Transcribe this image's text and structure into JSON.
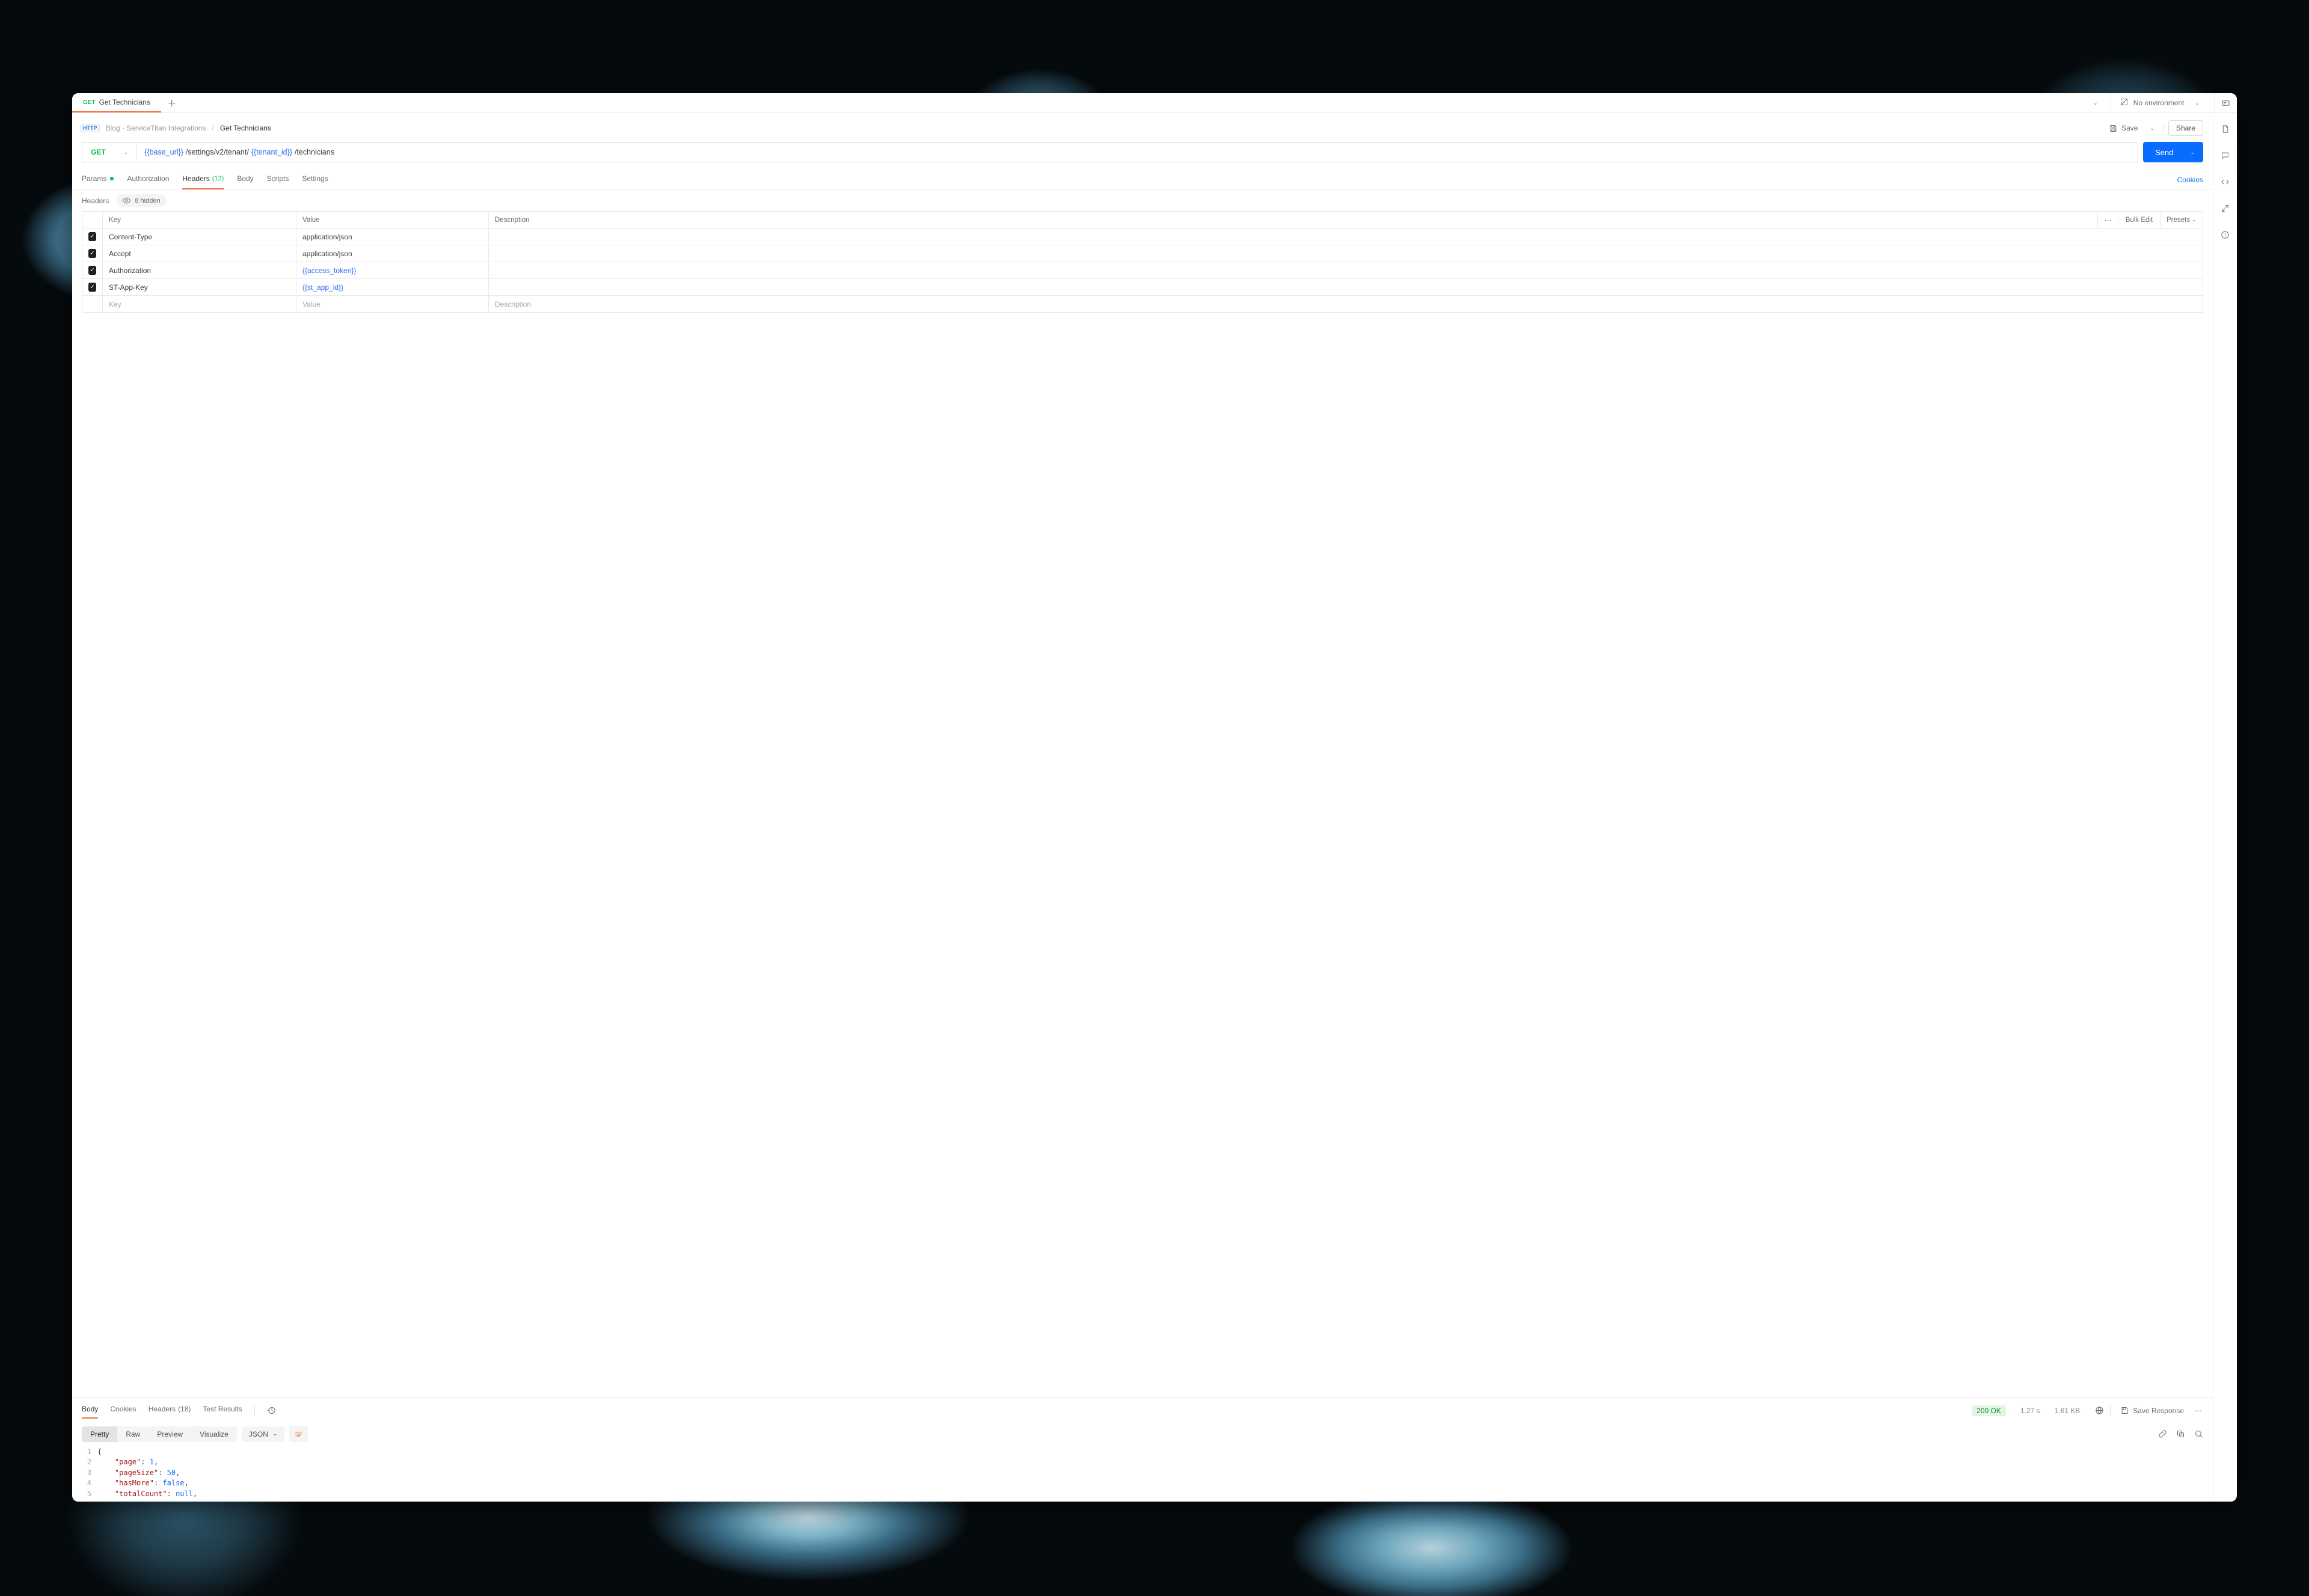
{
  "tabs": {
    "items": [
      {
        "method": "GET",
        "label": "Get Technicians",
        "active": true
      }
    ]
  },
  "environment": {
    "label": "No environment"
  },
  "breadcrumb": {
    "collection": "Blog - ServiceTitan Integrations",
    "request": "Get Technicians"
  },
  "actions": {
    "save": "Save",
    "share": "Share"
  },
  "urlbar": {
    "method": "GET",
    "parts": {
      "var1": "{{base_url}}",
      "seg1": " /settings/v2/tenant/ ",
      "var2": "{{tenant_id}}",
      "seg2": " /technicians"
    },
    "send": "Send"
  },
  "reqTabs": {
    "params": "Params",
    "authorization": "Authorization",
    "headers": "Headers",
    "headersCount": "(12)",
    "body": "Body",
    "scripts": "Scripts",
    "settings": "Settings",
    "cookies": "Cookies"
  },
  "headersSub": {
    "label": "Headers",
    "hidden": "8 hidden"
  },
  "headersTable": {
    "cols": {
      "key": "Key",
      "value": "Value",
      "description": "Description",
      "bulk": "Bulk Edit",
      "presets": "Presets"
    },
    "rows": [
      {
        "key": "Content-Type",
        "value": "application/json",
        "var": false
      },
      {
        "key": "Accept",
        "value": "application/json",
        "var": false
      },
      {
        "key": "Authorization",
        "value": "{{access_token}}",
        "var": true
      },
      {
        "key": "ST-App-Key",
        "value": "{{st_app_id}}",
        "var": true
      }
    ],
    "placeholders": {
      "key": "Key",
      "value": "Value",
      "description": "Description"
    }
  },
  "respTabs": {
    "body": "Body",
    "cookies": "Cookies",
    "headers": "Headers",
    "headersCount": "(18)",
    "testResults": "Test Results"
  },
  "respMeta": {
    "status": "200 OK",
    "time": "1.27 s",
    "size": "1.61 KB",
    "saveResponse": "Save Response"
  },
  "fmt": {
    "pretty": "Pretty",
    "raw": "Raw",
    "preview": "Preview",
    "visualize": "Visualize",
    "lang": "JSON"
  },
  "responseBody": {
    "lines": [
      {
        "n": 1,
        "tokens": [
          [
            "punct",
            "{"
          ]
        ]
      },
      {
        "n": 2,
        "tokens": [
          [
            "indent",
            "    "
          ],
          [
            "key",
            "\"page\""
          ],
          [
            "punct",
            ": "
          ],
          [
            "num",
            "1"
          ],
          [
            "punct",
            ","
          ]
        ]
      },
      {
        "n": 3,
        "tokens": [
          [
            "indent",
            "    "
          ],
          [
            "key",
            "\"pageSize\""
          ],
          [
            "punct",
            ": "
          ],
          [
            "num",
            "50"
          ],
          [
            "punct",
            ","
          ]
        ]
      },
      {
        "n": 4,
        "tokens": [
          [
            "indent",
            "    "
          ],
          [
            "key",
            "\"hasMore\""
          ],
          [
            "punct",
            ": "
          ],
          [
            "bool",
            "false"
          ],
          [
            "punct",
            ","
          ]
        ]
      },
      {
        "n": 5,
        "tokens": [
          [
            "indent",
            "    "
          ],
          [
            "key",
            "\"totalCount\""
          ],
          [
            "punct",
            ": "
          ],
          [
            "null",
            "null"
          ],
          [
            "punct",
            ","
          ]
        ]
      }
    ]
  }
}
